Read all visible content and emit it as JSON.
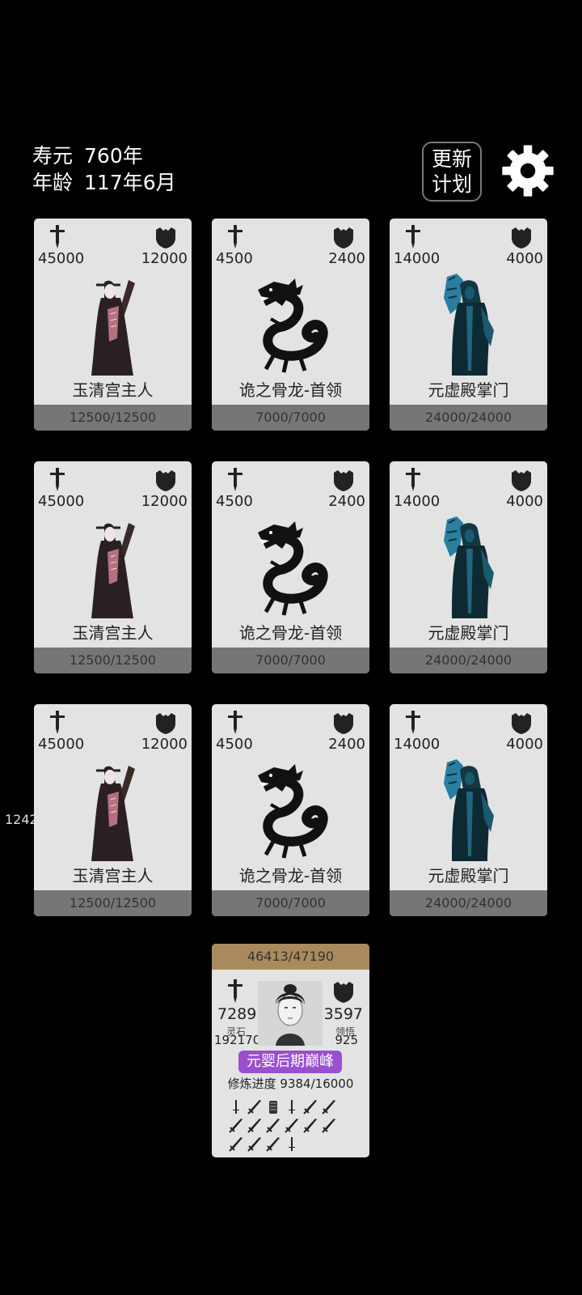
{
  "status": {
    "lifespan_label": "寿元",
    "lifespan_value": "760年",
    "age_label": "年龄",
    "age_value": "117年6月"
  },
  "header": {
    "update_plan_line1": "更新",
    "update_plan_line2": "计划",
    "settings_icon": "gear-icon"
  },
  "side_number": "1242",
  "enemies": [
    {
      "name": "玉清宫主人",
      "attack": "45000",
      "defense": "12000",
      "hp": "12500/12500",
      "portrait": "robed-cultivator"
    },
    {
      "name": "诡之骨龙-首领",
      "attack": "4500",
      "defense": "2400",
      "hp": "7000/7000",
      "portrait": "dragon"
    },
    {
      "name": "元虚殿掌门",
      "attack": "14000",
      "defense": "4000",
      "hp": "24000/24000",
      "portrait": "blue-sect-master"
    },
    {
      "name": "玉清宫主人",
      "attack": "45000",
      "defense": "12000",
      "hp": "12500/12500",
      "portrait": "robed-cultivator"
    },
    {
      "name": "诡之骨龙-首领",
      "attack": "4500",
      "defense": "2400",
      "hp": "7000/7000",
      "portrait": "dragon"
    },
    {
      "name": "元虚殿掌门",
      "attack": "14000",
      "defense": "4000",
      "hp": "24000/24000",
      "portrait": "blue-sect-master"
    },
    {
      "name": "玉清宫主人",
      "attack": "45000",
      "defense": "12000",
      "hp": "12500/12500",
      "portrait": "robed-cultivator"
    },
    {
      "name": "诡之骨龙-首领",
      "attack": "4500",
      "defense": "2400",
      "hp": "7000/7000",
      "portrait": "dragon"
    },
    {
      "name": "元虚殿掌门",
      "attack": "14000",
      "defense": "4000",
      "hp": "24000/24000",
      "portrait": "blue-sect-master"
    }
  ],
  "player": {
    "exp": "46413/47190",
    "attack": "7289",
    "defense": "3597",
    "stone_label": "灵石",
    "stone_value": "192170",
    "wisdom_label": "领悟",
    "wisdom_value": "925",
    "realm": "元婴后期巅峰",
    "progress_label": "修炼进度",
    "progress_value": "9384/16000",
    "weapon_count": 16
  },
  "colors": {
    "background": "#000000",
    "card_bg": "#e3e3e3",
    "hp_bar": "#767676",
    "exp_bar": "#a98a5c",
    "realm_badge": "#9a4fcf"
  }
}
